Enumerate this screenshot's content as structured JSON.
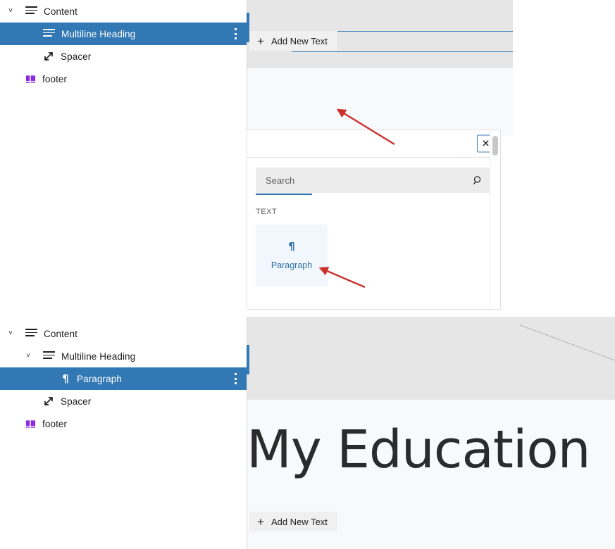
{
  "before": {
    "tree": {
      "items": [
        {
          "label": "Content",
          "icon": "heading-lines-icon",
          "depth": 0,
          "chevron": "˅",
          "selected": false,
          "kebab": false
        },
        {
          "label": "Multiline Heading",
          "icon": "heading-lines-icon",
          "depth": 1,
          "chevron": "",
          "selected": true,
          "kebab": true
        },
        {
          "label": "Spacer",
          "icon": "spacer-arrow-icon",
          "depth": 1,
          "chevron": "",
          "selected": false,
          "kebab": false
        },
        {
          "label": "footer",
          "icon": "footer-block-icon",
          "depth": 0,
          "chevron": "",
          "selected": false,
          "kebab": false
        }
      ]
    },
    "preview": {
      "add_button_label": "Add New Text",
      "add_button_plus": "+"
    }
  },
  "inserter": {
    "close_label": "✕",
    "search": {
      "placeholder": "Search",
      "value": "",
      "icon": "search-icon"
    },
    "section_title": "TEXT",
    "blocks": [
      {
        "label": "Paragraph",
        "glyph": "¶",
        "icon": "pilcrow-icon"
      }
    ]
  },
  "after": {
    "tree": {
      "items": [
        {
          "label": "Content",
          "icon": "heading-lines-icon",
          "depth": 0,
          "chevron": "˅",
          "selected": false,
          "kebab": false
        },
        {
          "label": "Multiline Heading",
          "icon": "heading-lines-icon",
          "depth": 1,
          "chevron": "˅",
          "selected": false,
          "kebab": false
        },
        {
          "label": "Paragraph",
          "icon": "pilcrow-icon",
          "depth": 2,
          "chevron": "",
          "selected": true,
          "kebab": true
        },
        {
          "label": "Spacer",
          "icon": "spacer-arrow-icon",
          "depth": 1,
          "chevron": "",
          "selected": false,
          "kebab": false
        },
        {
          "label": "footer",
          "icon": "footer-block-icon",
          "depth": 0,
          "chevron": "",
          "selected": false,
          "kebab": false
        }
      ]
    },
    "preview": {
      "heading_text": "My Education",
      "add_button_label": "Add New Text",
      "add_button_plus": "+"
    }
  },
  "colors": {
    "selection_blue": "#3278b4",
    "accent_blue": "#2e6fa8",
    "annotation_red": "#c9302c",
    "footer_purple": "#8a2be2",
    "panel_gray": "#e6e6e6",
    "canvas_gray": "#f8f9fb",
    "search_gray": "#ececec",
    "card_blue": "#f1f7fc"
  },
  "annotations": [
    {
      "name": "arrow-to-add-new-text"
    },
    {
      "name": "arrow-to-paragraph-block"
    }
  ]
}
